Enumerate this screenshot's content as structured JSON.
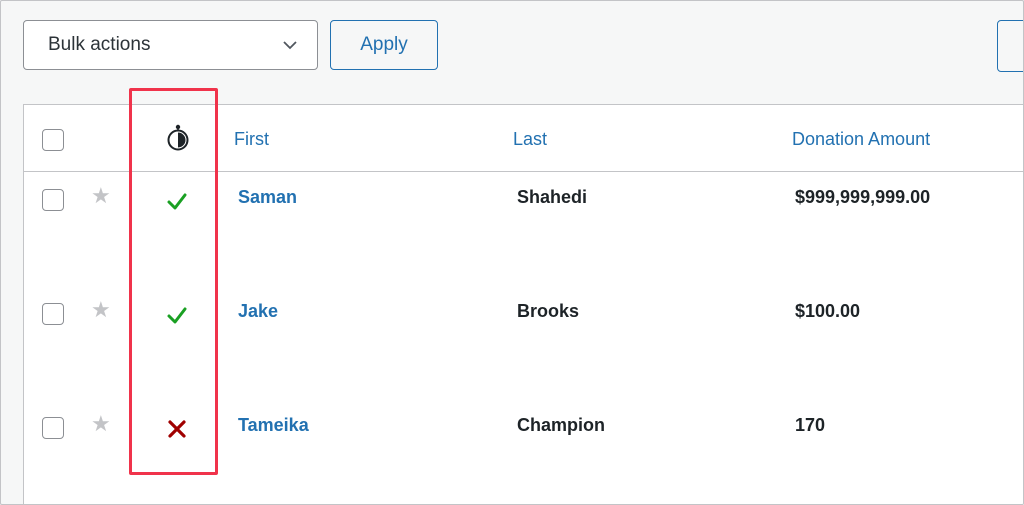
{
  "toolbar": {
    "bulk_actions_label": "Bulk actions",
    "apply_label": "Apply"
  },
  "table": {
    "columns": {
      "approval_icon": "approval-icon",
      "first": "First",
      "last": "Last",
      "donation": "Donation Amount"
    },
    "rows": [
      {
        "first": "Saman",
        "last": "Shahedi",
        "amount": "$999,999,999.00",
        "status": "approved"
      },
      {
        "first": "Jake",
        "last": "Brooks",
        "amount": "$100.00",
        "status": "approved"
      },
      {
        "first": "Tameika",
        "last": "Champion",
        "amount": "170",
        "status": "rejected"
      }
    ]
  },
  "colors": {
    "link": "#2271b1",
    "approved": "#1aa023",
    "rejected": "#a00000",
    "highlight": "#f0334b"
  }
}
